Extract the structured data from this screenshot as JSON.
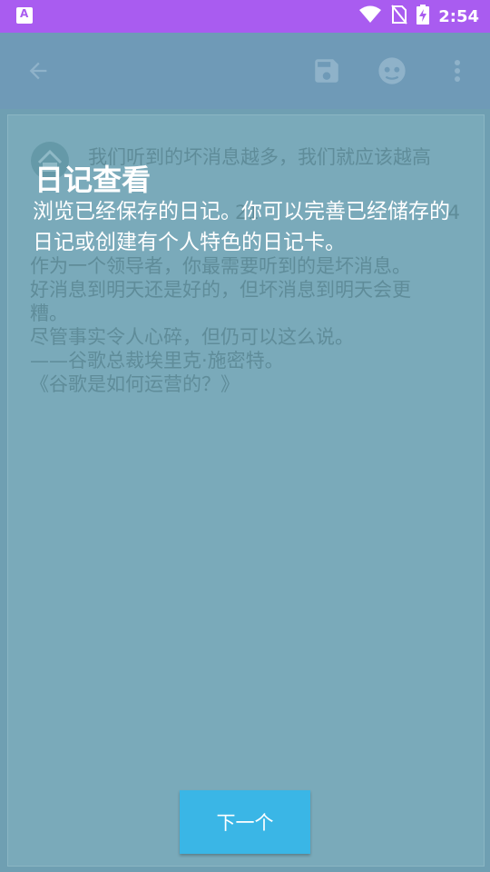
{
  "status_bar": {
    "time": "2:54",
    "app_badge": "A",
    "icons": [
      "wifi-icon",
      "no-sim-icon",
      "battery-charging-icon"
    ]
  },
  "app_bar": {
    "icons": [
      "back-arrow-icon",
      "save-icon",
      "avatar-icon",
      "more-vert-icon"
    ]
  },
  "entry": {
    "title": "我们听到的坏消息越多，我们就应该越高",
    "date_left": "21",
    "date_right": "4",
    "body_lines": [
      "作为一个领导者，你最需要听到的是坏消息。",
      "好消息到明天还是好的，但坏消息到明天会更",
      "糟。",
      "尽管事实令人心碎，但仍可以这么说。",
      "——谷歌总裁埃里克·施密特。",
      "《谷歌是如何运营的？》"
    ]
  },
  "overlay": {
    "title": "日记查看",
    "description": "浏览已经保存的日记。你可以完善已经储存的日记或创建有个人特色的日记卡。"
  },
  "next_button": {
    "label": "下一个"
  },
  "colors": {
    "status_bar": "#a95cf0",
    "app_bar": "#6f9ab7",
    "background": "#6f9fb2",
    "card": "#7aaaba",
    "next_button": "#3ab6e6"
  }
}
